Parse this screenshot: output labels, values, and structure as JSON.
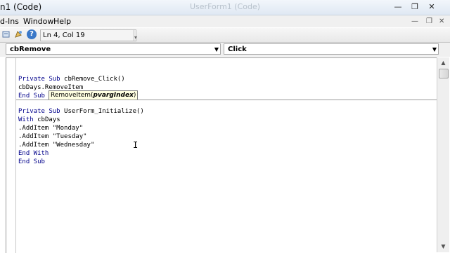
{
  "window": {
    "title": "n1 (Code)",
    "faded_title": "UserForm1 (Code)",
    "controls": {
      "minimize": "—",
      "restore": "❐",
      "close": "✕"
    }
  },
  "menu": {
    "items": [
      "d-Ins",
      "Window",
      "Help"
    ],
    "controls": {
      "minimize": "—",
      "restore": "❐",
      "close": "✕"
    }
  },
  "toolbar": {
    "icons": [
      "toolbar-button-icon",
      "object-browser-icon",
      "help-icon"
    ],
    "help_glyph": "?",
    "status": "Ln 4, Col 19",
    "grip": "▾"
  },
  "combos": {
    "object": {
      "value": "cbRemove",
      "arrow": "▼"
    },
    "procedure": {
      "value": "Click",
      "arrow": "▼"
    }
  },
  "code": {
    "lines": [
      "Private Sub cbRemove_Click()",
      "cbDays.RemoveItem",
      "End Sub",
      "Private Sub UserForm_Initialize()",
      "With cbDays",
      ".AddItem \"Monday\"",
      ".AddItem \"Tuesday\"",
      ".AddItem \"Wednesday\"",
      "End With",
      "End Sub"
    ],
    "tooltip_method": "RemoveItem(",
    "tooltip_param": "pvargIndex",
    "tooltip_close": ")"
  },
  "scrollbar": {
    "up": "▲",
    "down": "▼"
  },
  "cursor_glyph": "I",
  "colors": {
    "keyword": "#00008b",
    "tooltip_bg": "#ffffe1",
    "help_icon": "#3a78c8"
  }
}
